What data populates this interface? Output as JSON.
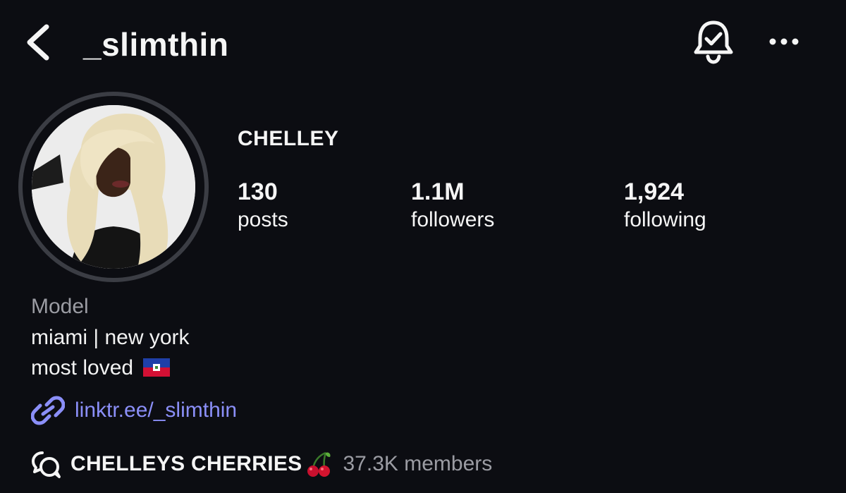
{
  "header": {
    "username": "_slimthin",
    "back_icon": "chevron-left-icon",
    "notification_icon": "bell-check-icon",
    "more_icon": "more-horizontal-icon"
  },
  "profile": {
    "display_name": "CHELLEY",
    "stats": [
      {
        "value": "130",
        "label": "posts"
      },
      {
        "value": "1.1M",
        "label": "followers"
      },
      {
        "value": "1,924",
        "label": "following"
      }
    ]
  },
  "bio": {
    "category": "Model",
    "lines": [
      "miami | new york",
      "most loved"
    ],
    "flag_icon": "haiti-flag-icon"
  },
  "link": {
    "text": "linktr.ee/_slimthin",
    "icon": "link-icon"
  },
  "channel": {
    "name": "CHELLEYS CHERRIES",
    "members": "37.3K members",
    "icon": "broadcast-chat-icon",
    "emoji_icon": "cherries-icon"
  },
  "colors": {
    "background": "#0c0d12",
    "link": "#8b8ff8",
    "secondary_text": "#9b9ca3"
  }
}
